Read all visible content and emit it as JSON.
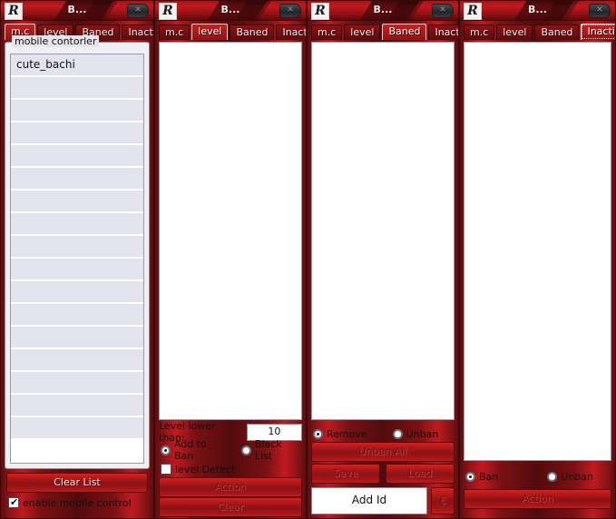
{
  "window": {
    "title": "B...",
    "logo_text": "R",
    "close_label": "✕"
  },
  "tabs": [
    "m.c",
    "level",
    "Baned",
    "Inactive"
  ],
  "panel_mc": {
    "group_label": "mobile contorler",
    "list_items": [
      "cute_bachi",
      "",
      "",
      "",
      "",
      "",
      "",
      "",
      "",
      "",
      "",
      "",
      "",
      "",
      "",
      "",
      ""
    ],
    "clear_list_label": "Clear List",
    "enable_label": "enable mobile control",
    "enable_checked": true
  },
  "panel_level": {
    "level_label": "Level lower than:",
    "level_value": "10",
    "radio_add_to_ban": "Add to Ban",
    "radio_black_list": "Black List",
    "selected_radio": "Add to Ban",
    "level_detect_label": "level Detect",
    "level_detect_checked": false,
    "action_label": "Action",
    "clear_label": "Clear"
  },
  "panel_baned": {
    "radio_remove": "Remove",
    "radio_unban": "Unban",
    "selected_radio": "Remove",
    "unban_all_label": "Unban All",
    "save_label": "Save",
    "load_label": "Load",
    "add_id_placeholder": "Add Id",
    "add_id_value": "",
    "add_button_label": "€"
  },
  "panel_inactive": {
    "radio_ban": "Ban",
    "radio_unban": "Unban",
    "selected_radio": "Ban",
    "action_label": "Action"
  },
  "colors": {
    "frame_red": "#c01a1f",
    "button_red": "#bb1a1b",
    "list_row": "#e3e3ee"
  }
}
